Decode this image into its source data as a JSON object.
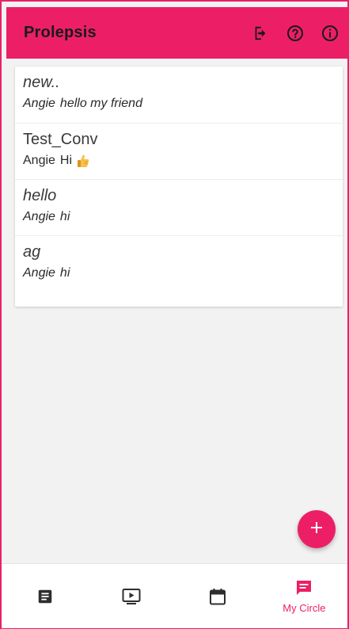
{
  "app": {
    "title": "Prolepsis",
    "accent_color": "#ec1f66"
  },
  "toolbar": {
    "actions": [
      {
        "icon": "logout-icon"
      },
      {
        "icon": "help-circle-icon"
      },
      {
        "icon": "info-icon"
      }
    ]
  },
  "conversations": [
    {
      "title": "new..",
      "sender": "Angie",
      "message": "hello my friend",
      "italic": true,
      "emoji": ""
    },
    {
      "title": "Test_Conv",
      "sender": "Angie",
      "message": "Hi",
      "italic": false,
      "emoji": "thumbs-up-emoji"
    },
    {
      "title": "hello",
      "sender": "Angie",
      "message": "hi",
      "italic": true,
      "emoji": ""
    },
    {
      "title": "ag",
      "sender": "Angie",
      "message": "hi",
      "italic": true,
      "emoji": ""
    }
  ],
  "fab": {
    "icon": "plus-icon"
  },
  "bottom_nav": {
    "items": [
      {
        "icon": "article-icon",
        "label": "",
        "active": false
      },
      {
        "icon": "video-play-icon",
        "label": "",
        "active": false
      },
      {
        "icon": "calendar-icon",
        "label": "",
        "active": false
      },
      {
        "icon": "chat-icon",
        "label": "My Circle",
        "active": true
      }
    ]
  }
}
